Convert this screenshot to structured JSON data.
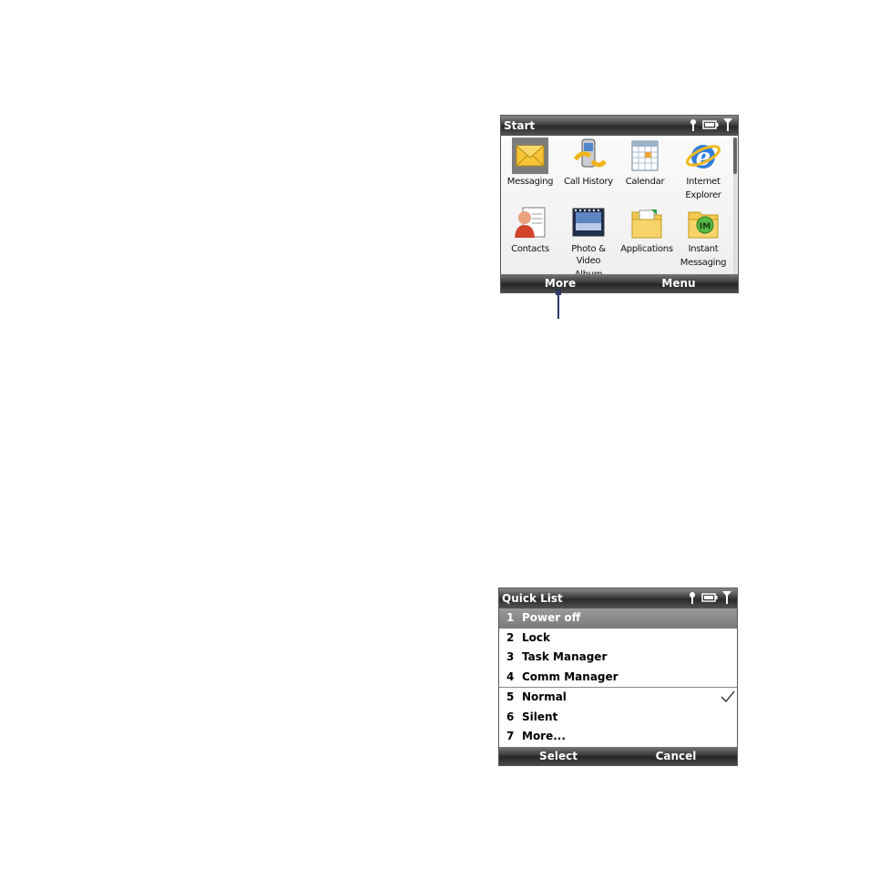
{
  "start_screen": {
    "title": "Start",
    "status_icons": [
      "signal-antenna-icon",
      "battery-icon",
      "signal-strength-icon"
    ],
    "tiles": [
      {
        "label_lines": [
          "Messaging",
          ""
        ],
        "icon": "messaging-envelope-icon"
      },
      {
        "label_lines": [
          "Call History",
          ""
        ],
        "icon": "call-history-phone-icon"
      },
      {
        "label_lines": [
          "Calendar",
          ""
        ],
        "icon": "calendar-icon"
      },
      {
        "label_lines": [
          "Internet",
          "Explorer"
        ],
        "icon": "internet-explorer-icon"
      },
      {
        "label_lines": [
          "Contacts",
          ""
        ],
        "icon": "contacts-icon"
      },
      {
        "label_lines": [
          "Photo & Video",
          "Album"
        ],
        "icon": "photo-video-album-icon"
      },
      {
        "label_lines": [
          "Applications",
          ""
        ],
        "icon": "applications-folder-icon"
      },
      {
        "label_lines": [
          "Instant",
          "Messaging"
        ],
        "icon": "instant-messaging-folder-icon"
      }
    ],
    "softkey_left": "More",
    "softkey_right": "Menu"
  },
  "quick_list": {
    "title": "Quick List",
    "status_icons": [
      "signal-antenna-icon",
      "battery-icon",
      "signal-strength-icon"
    ],
    "items": [
      {
        "num": "1",
        "label": "Power off",
        "selected": true
      },
      {
        "num": "2",
        "label": "Lock"
      },
      {
        "num": "3",
        "label": "Task Manager"
      },
      {
        "num": "4",
        "label": "Comm Manager"
      },
      {
        "num": "5",
        "label": "Normal",
        "checked": true
      },
      {
        "num": "6",
        "label": "Silent"
      },
      {
        "num": "7",
        "label": "More..."
      }
    ],
    "softkey_left": "Select",
    "softkey_right": "Cancel"
  },
  "colors": {
    "bar_dark": "#2a2a2a",
    "selection": "#8a8a8a",
    "connector": "#2b3a67"
  }
}
